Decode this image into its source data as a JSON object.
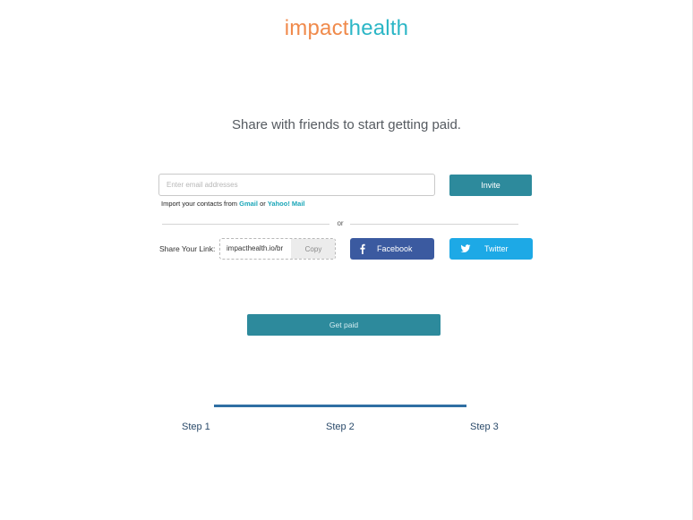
{
  "brand": {
    "part1": "impact",
    "part2": "health",
    "color1": "#f08a4b",
    "color2": "#2bb6c6"
  },
  "headline": "Share with friends to start getting paid.",
  "invite": {
    "email_placeholder": "Enter email addresses",
    "email_value": "",
    "button_label": "Invite",
    "button_color": "#2d8a9c"
  },
  "import": {
    "prefix": "Import your contacts from",
    "gmail": "Gmail",
    "or": "or",
    "yahoo": "Yahoo! Mail",
    "link_color": "#1aa6b8"
  },
  "divider_text": "or",
  "share": {
    "label": "Share Your Link:",
    "link_text": "impacthealth.io/br",
    "copy_label": "Copy",
    "facebook": {
      "label": "Facebook",
      "icon": "facebook-icon",
      "color": "#3b5aa0"
    },
    "twitter": {
      "label": "Twitter",
      "icon": "twitter-icon",
      "color": "#1da9e6"
    }
  },
  "cta": {
    "label": "Get paid"
  },
  "steps": {
    "items": [
      "Step 1",
      "Step 2",
      "Step 3"
    ],
    "bar_color": "#2f6fa3"
  }
}
